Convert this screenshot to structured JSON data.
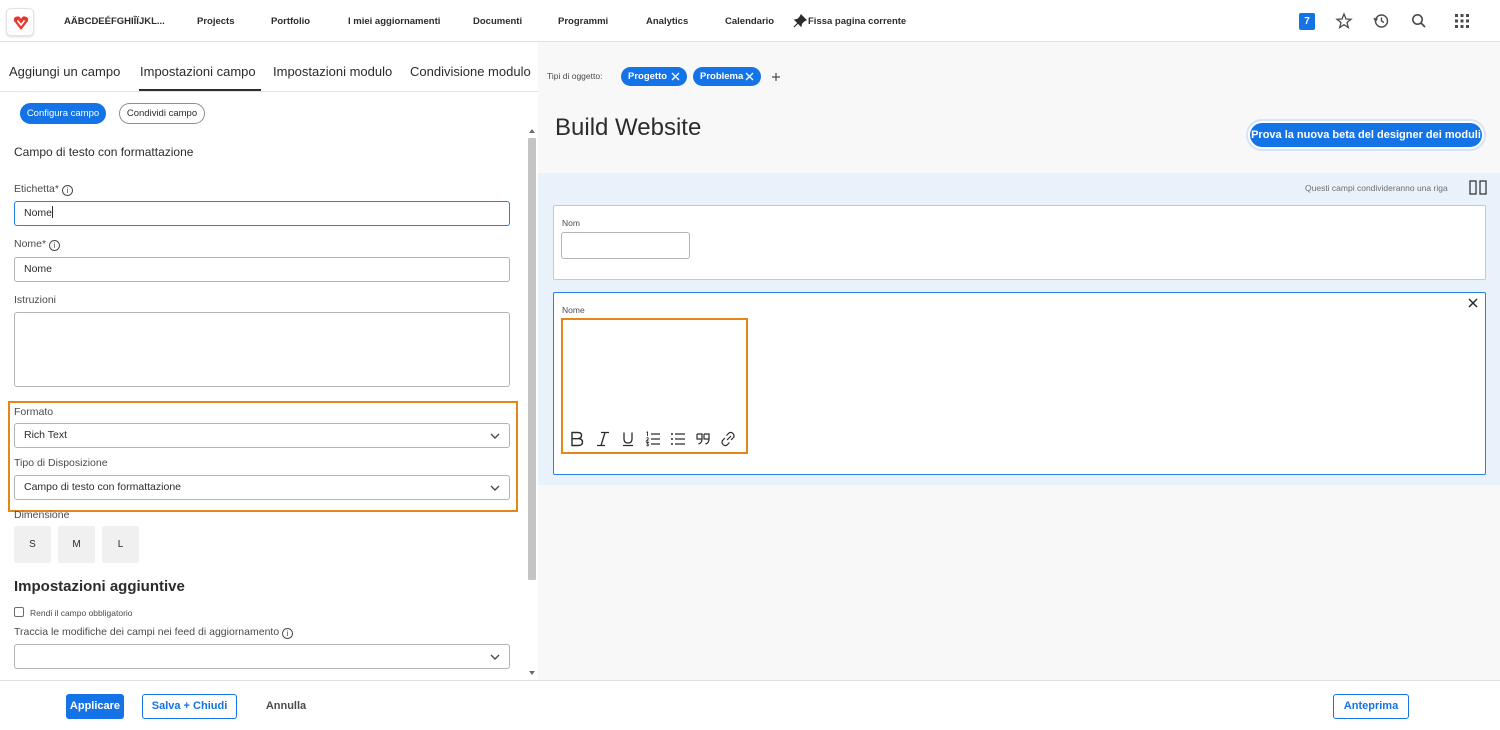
{
  "topnav": {
    "account_name": "AÄBCDEÉFGHIÎÏJKL...",
    "links": [
      "Projects",
      "Portfolio",
      "I miei aggiornamenti",
      "Documenti",
      "Programmi",
      "Analytics",
      "Calendario"
    ],
    "pin_label": "Fissa pagina corrente",
    "notification_count": "7",
    "icons": [
      "star-icon",
      "history-icon",
      "search-icon",
      "apps-grid-icon"
    ]
  },
  "left": {
    "tabs": [
      "Aggiungi un campo",
      "Impostazioni campo",
      "Impostazioni modulo",
      "Condivisione modulo"
    ],
    "active_tab": "Impostazioni campo",
    "pills": {
      "configure": "Configura campo",
      "share": "Condividi campo"
    },
    "section_title": "Campo di testo con formattazione",
    "label_field": {
      "label": "Etichetta*",
      "value": "Nome"
    },
    "name_field": {
      "label": "Nome*",
      "value": "Nome"
    },
    "instructions": {
      "label": "Istruzioni",
      "value": ""
    },
    "format": {
      "label": "Formato",
      "value": "Rich Text"
    },
    "layout_type": {
      "label": "Tipo di Disposizione",
      "value": "Campo di testo con formattazione"
    },
    "size": {
      "label": "Dimensione",
      "options": [
        "S",
        "M",
        "L"
      ]
    },
    "additional_title": "Impostazioni aggiuntive",
    "required_checkbox": {
      "label": "Rendi il campo obbligatorio",
      "checked": false
    },
    "track_changes": {
      "label": "Traccia le modifiche dei campi nei feed di aggiornamento",
      "value": ""
    }
  },
  "bottom": {
    "apply": "Applicare",
    "save_close": "Salva + Chiudi",
    "cancel": "Annulla",
    "preview": "Anteprima"
  },
  "right": {
    "object_types_label": "Tipi di oggetto:",
    "object_types": [
      "Progetto",
      "Problema"
    ],
    "form_title": "Build Website",
    "beta_button": "Prova la nuova beta del designer dei moduli",
    "row_hint": "Questi campi condivideranno una riga",
    "field1_label": "Nom",
    "field2_label": "Nome",
    "toolbar_icons": [
      "bold-icon",
      "italic-icon",
      "underline-icon",
      "numbered-list-icon",
      "bullet-list-icon",
      "quote-icon",
      "link-icon"
    ]
  },
  "colors": {
    "accent": "#1473e6",
    "highlight": "#e68619"
  }
}
